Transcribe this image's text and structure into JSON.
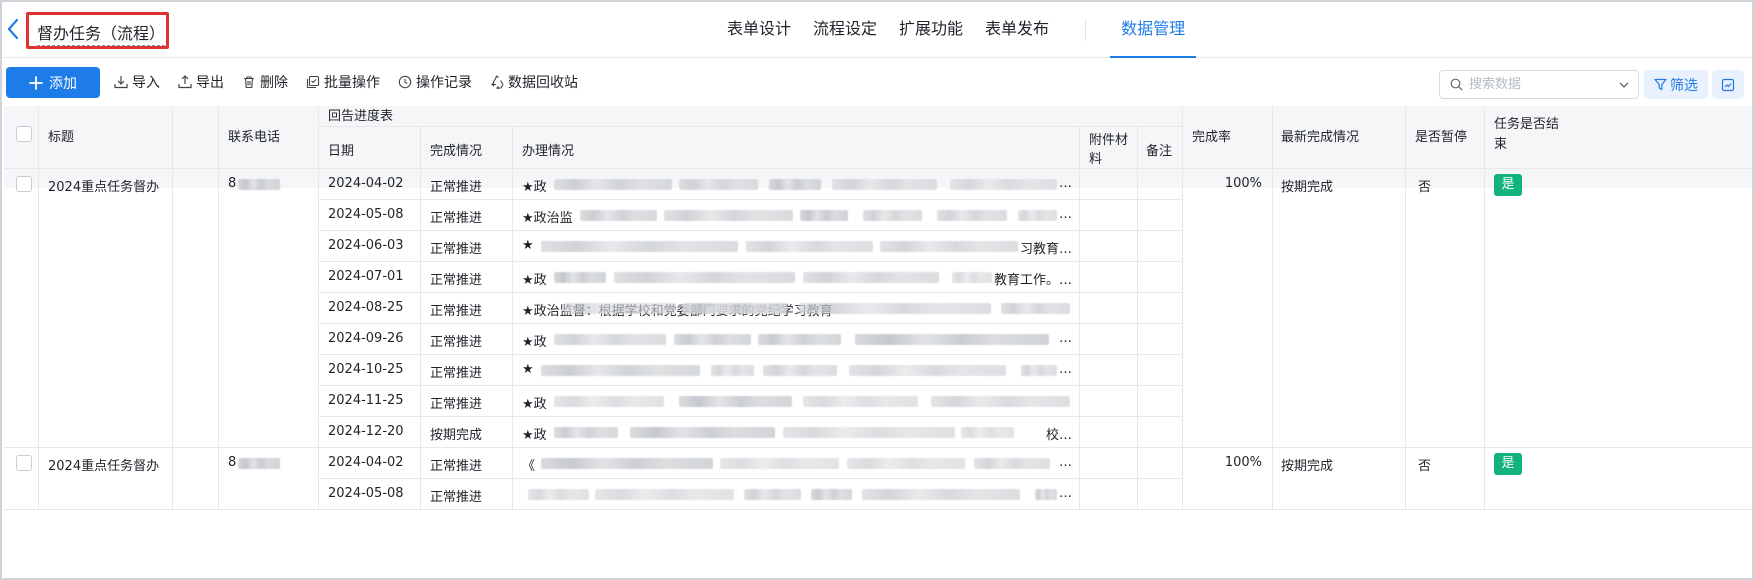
{
  "header": {
    "title": "督办任务（流程）",
    "tabs": [
      "表单设计",
      "流程设定",
      "扩展功能",
      "表单发布"
    ],
    "active_tab": "数据管理"
  },
  "toolbar": {
    "add_label": "添加",
    "tools": [
      "导入",
      "导出",
      "删除",
      "批量操作",
      "操作记录",
      "数据回收站"
    ],
    "search_placeholder": "搜索数据",
    "filter_label": "筛选"
  },
  "table": {
    "columns": {
      "title": "标题",
      "phone": "联系电话",
      "group": "回告进度表",
      "date": "日期",
      "status": "完成情况",
      "handling": "办理情况",
      "attach": "附件材料",
      "note": "备注",
      "rate": "完成率",
      "latest": "最新完成情况",
      "paused": "是否暂停",
      "ended": "任务是否结束"
    },
    "records": [
      {
        "title": "2024重点任务督办",
        "phone": "8",
        "rate": "100%",
        "latest": "按期完成",
        "paused": "否",
        "ended": "是",
        "rows": [
          {
            "date": "2024-04-02",
            "status": "正常推进",
            "handling": "★政",
            "tail": "…"
          },
          {
            "date": "2024-05-08",
            "status": "正常推进",
            "handling": "★政治监",
            "tail": "…"
          },
          {
            "date": "2024-06-03",
            "status": "正常推进",
            "handling": "★",
            "tail": "习教育…"
          },
          {
            "date": "2024-07-01",
            "status": "正常推进",
            "handling": "★政",
            "tail": "教育工作。…"
          },
          {
            "date": "2024-08-25",
            "status": "正常推进",
            "handling": "★政治监督：根据学校和党委部门要求的党纪学习教育",
            "tail": ""
          },
          {
            "date": "2024-09-26",
            "status": "正常推进",
            "handling": "★政",
            "tail": "…"
          },
          {
            "date": "2024-10-25",
            "status": "正常推进",
            "handling": "★",
            "tail": "…"
          },
          {
            "date": "2024-11-25",
            "status": "正常推进",
            "handling": "★政",
            "tail": ""
          },
          {
            "date": "2024-12-20",
            "status": "按期完成",
            "handling": "★政",
            "tail": "校…"
          }
        ]
      },
      {
        "title": "2024重点任务督办",
        "phone": "8",
        "rate": "100%",
        "latest": "按期完成",
        "paused": "否",
        "ended": "是",
        "rows": [
          {
            "date": "2024-04-02",
            "status": "正常推进",
            "handling": "《",
            "tail": "…"
          },
          {
            "date": "2024-05-08",
            "status": "正常推进",
            "handling": "",
            "tail": "…"
          }
        ]
      }
    ]
  }
}
